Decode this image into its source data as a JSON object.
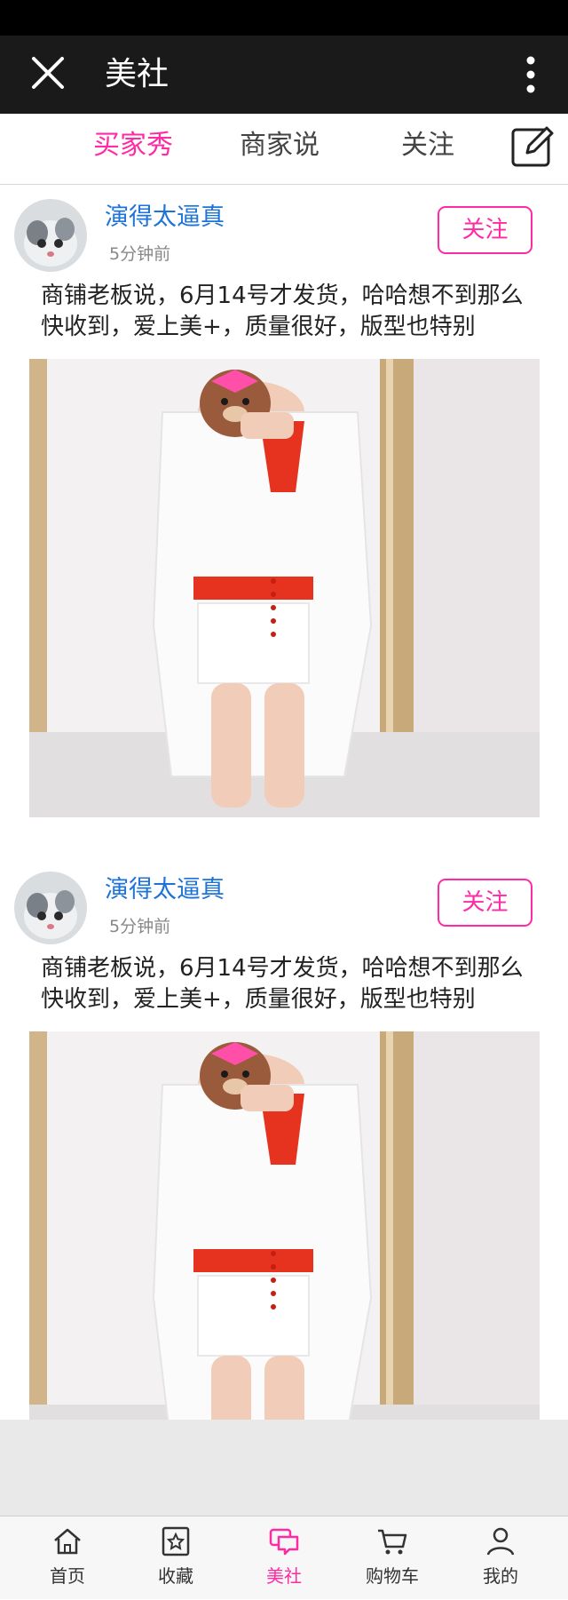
{
  "header": {
    "title": "美社",
    "close_icon": "close-icon",
    "more_icon": "more-vertical-icon"
  },
  "tabs": [
    {
      "label": "买家秀",
      "active": true
    },
    {
      "label": "商家说",
      "active": false
    },
    {
      "label": "关注",
      "active": false
    }
  ],
  "edit_icon": "edit-icon",
  "posts": [
    {
      "username": "演得太逼真",
      "time": "5分钟前",
      "follow_label": "关注",
      "text": "商铺老板说，6月14号才发货，哈哈想不到那么快收到，爱上美+，质量很好，版型也特别"
    },
    {
      "username": "演得太逼真",
      "time": "5分钟前",
      "follow_label": "关注",
      "text": "商铺老板说，6月14号才发货，哈哈想不到那么快收到，爱上美+，质量很好，版型也特别"
    }
  ],
  "bottom_nav": [
    {
      "label": "首页",
      "icon": "home-icon",
      "active": false
    },
    {
      "label": "收藏",
      "icon": "star-box-icon",
      "active": false
    },
    {
      "label": "美社",
      "icon": "chat-icon",
      "active": true
    },
    {
      "label": "购物车",
      "icon": "cart-icon",
      "active": false
    },
    {
      "label": "我的",
      "icon": "user-icon",
      "active": false
    }
  ],
  "colors": {
    "accent": "#ff2aa4",
    "username": "#1e73d8",
    "header_bg": "#1a1a1a"
  }
}
